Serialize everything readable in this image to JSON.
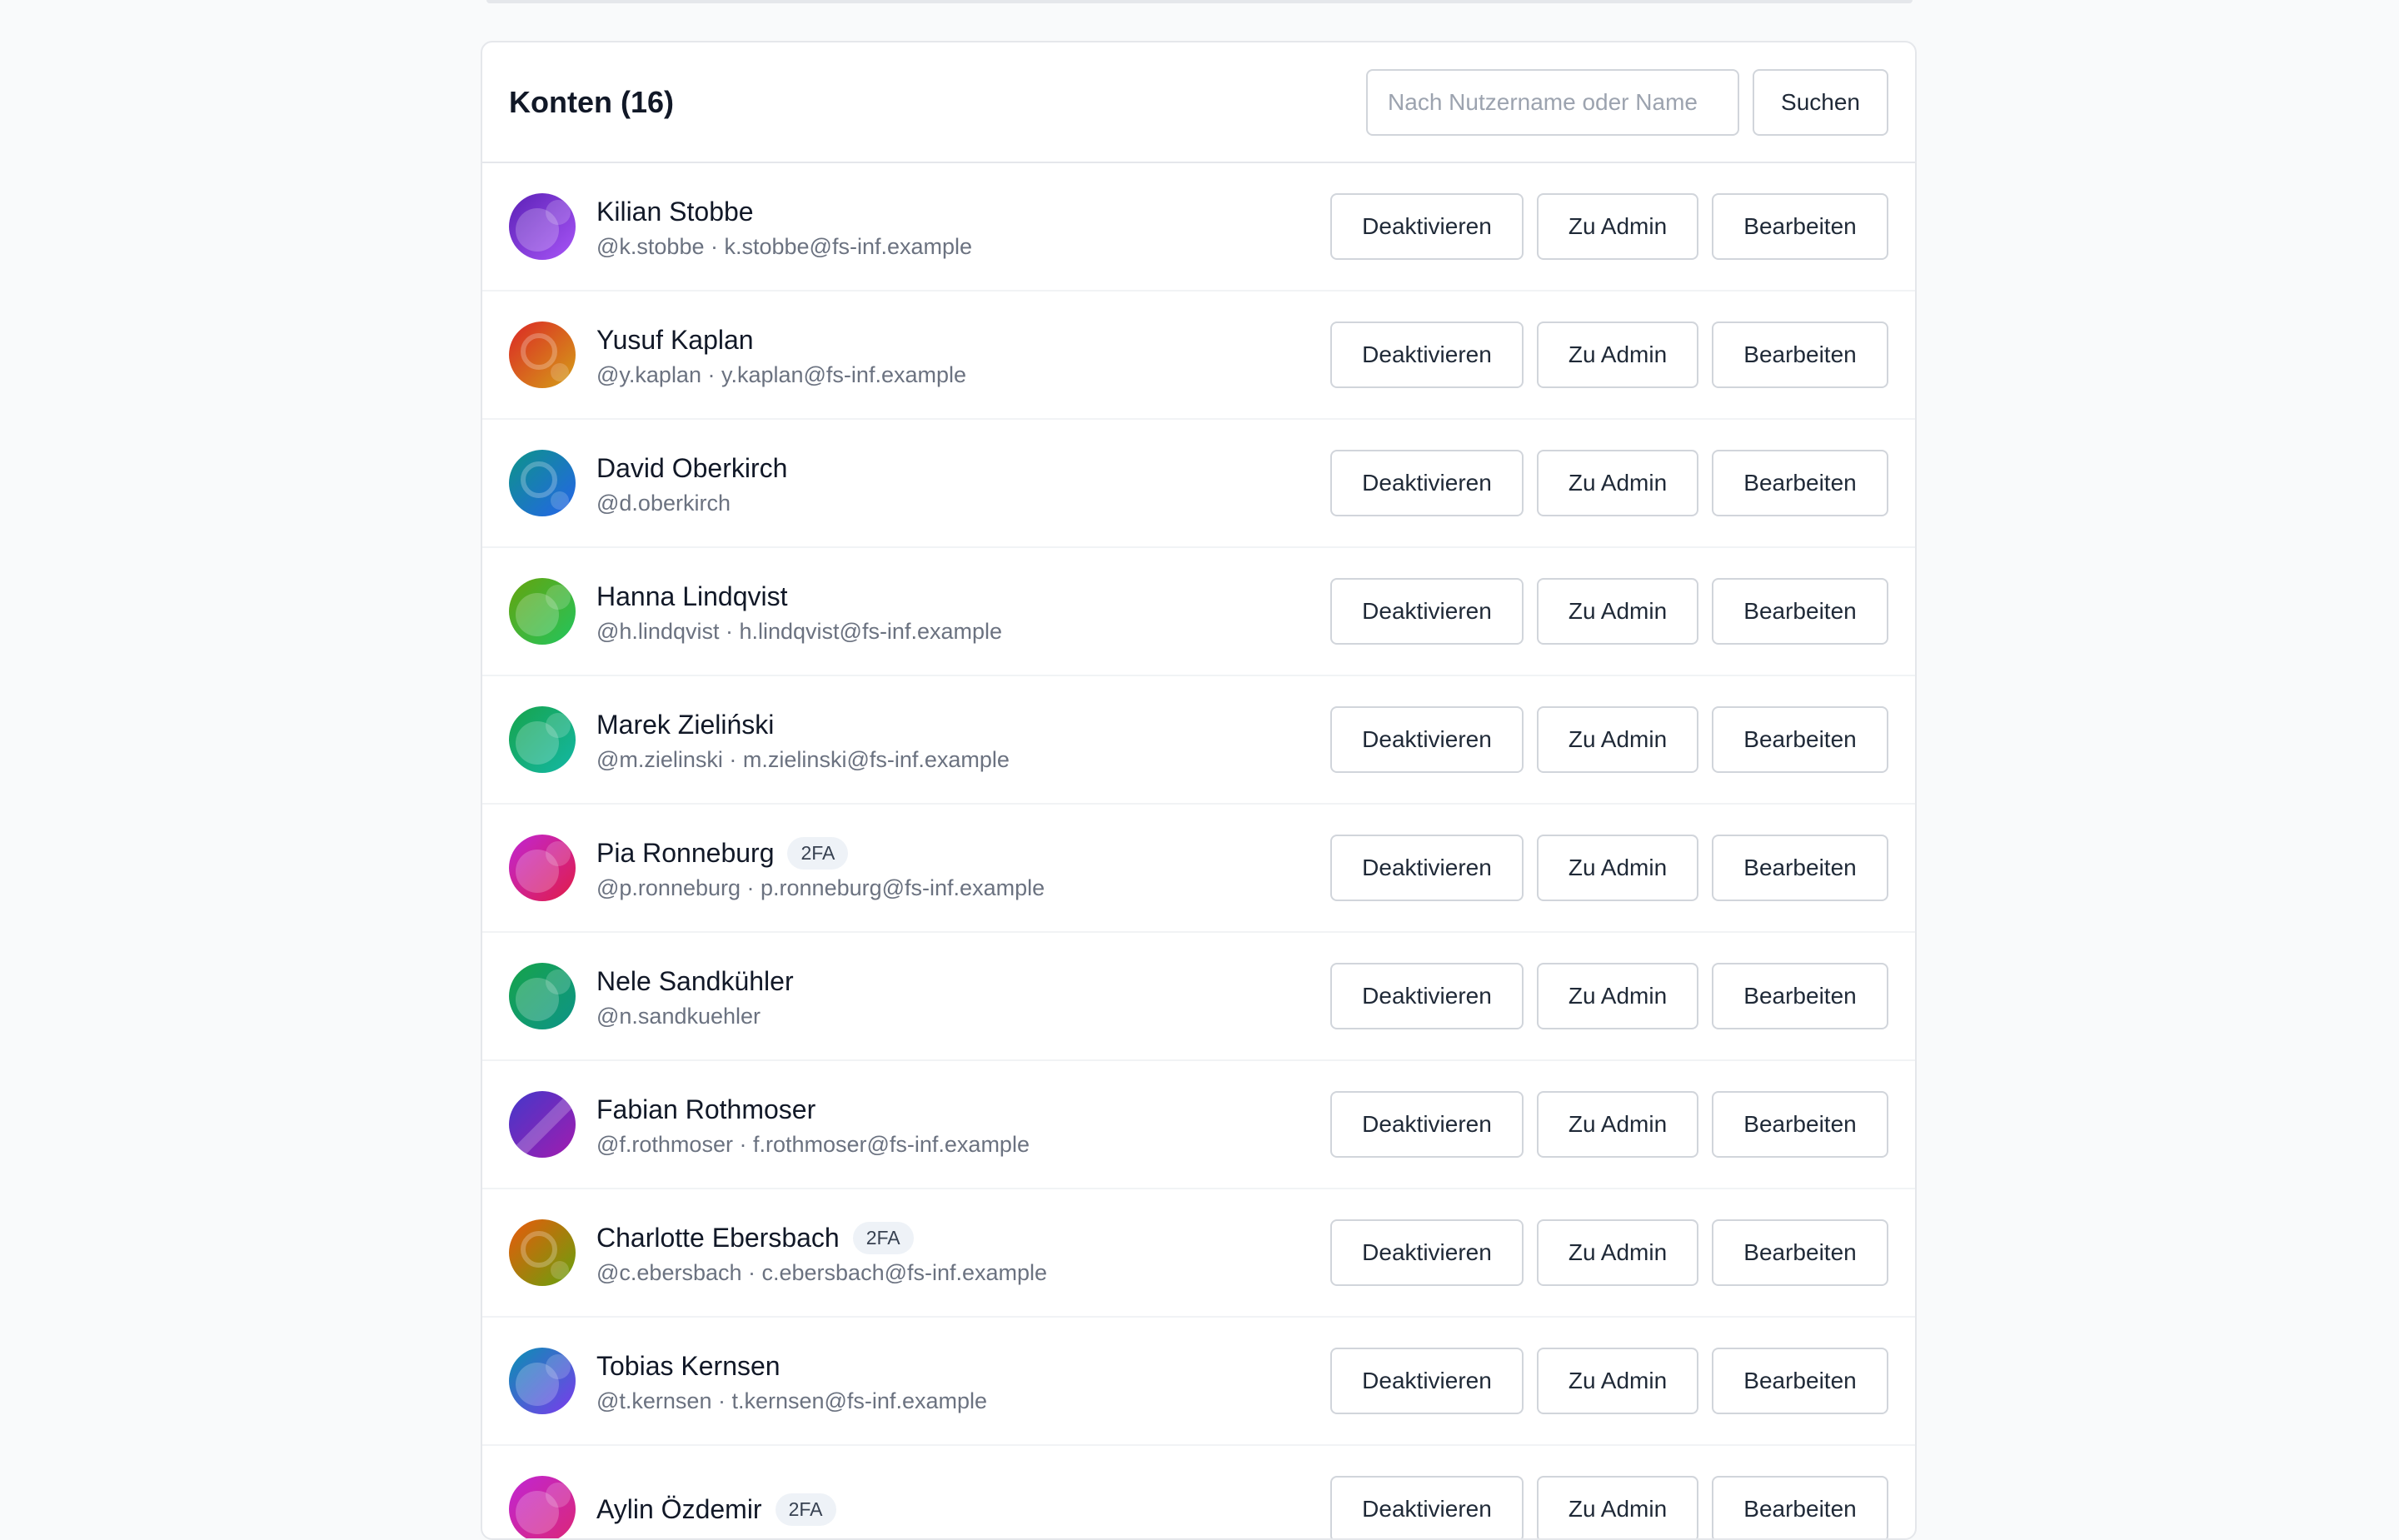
{
  "header": {
    "title": "Konten (16)",
    "search_placeholder": "Nach Nutzername oder Name",
    "search_value": "",
    "search_button": "Suchen"
  },
  "actions": {
    "deactivate": "Deaktivieren",
    "make_admin": "Zu Admin",
    "edit": "Bearbeiten"
  },
  "users": [
    {
      "name": "Kilian Stobbe",
      "sub": "@k.stobbe · k.stobbe@fs-inf.example",
      "badge": "",
      "color1": "#5b21b6",
      "color2": "#a855f7",
      "pattern": "blobs"
    },
    {
      "name": "Yusuf Kaplan",
      "sub": "@y.kaplan · y.kaplan@fs-inf.example",
      "badge": "",
      "color1": "#dc2626",
      "color2": "#d4a017",
      "pattern": "ring"
    },
    {
      "name": "David Oberkirch",
      "sub": "@d.oberkirch",
      "badge": "",
      "color1": "#0d9488",
      "color2": "#2563eb",
      "pattern": "ring"
    },
    {
      "name": "Hanna Lindqvist",
      "sub": "@h.lindqvist · h.lindqvist@fs-inf.example",
      "badge": "",
      "color1": "#65a30d",
      "color2": "#22c55e",
      "pattern": "blobs"
    },
    {
      "name": "Marek Zieliński",
      "sub": "@m.zielinski · m.zielinski@fs-inf.example",
      "badge": "",
      "color1": "#16a34a",
      "color2": "#14b8a6",
      "pattern": "blobs"
    },
    {
      "name": "Pia Ronneburg",
      "sub": "@p.ronneburg · p.ronneburg@fs-inf.example",
      "badge": "2FA",
      "color1": "#c026d3",
      "color2": "#e11d48",
      "pattern": "blobs"
    },
    {
      "name": "Nele Sandkühler",
      "sub": "@n.sandkuehler",
      "badge": "",
      "color1": "#16a34a",
      "color2": "#0d9488",
      "pattern": "blobs"
    },
    {
      "name": "Fabian Rothmoser",
      "sub": "@f.rothmoser · f.rothmoser@fs-inf.example",
      "badge": "",
      "color1": "#4338ca",
      "color2": "#a21caf",
      "pattern": "stripe"
    },
    {
      "name": "Charlotte Ebersbach",
      "sub": "@c.ebersbach · c.ebersbach@fs-inf.example",
      "badge": "2FA",
      "color1": "#ea580c",
      "color2": "#65a30d",
      "pattern": "ring"
    },
    {
      "name": "Tobias Kernsen",
      "sub": "@t.kernsen · t.kernsen@fs-inf.example",
      "badge": "",
      "color1": "#0891b2",
      "color2": "#7c3aed",
      "pattern": "blobs"
    },
    {
      "name": "Aylin Özdemir",
      "sub": "",
      "badge": "2FA",
      "color1": "#c026d3",
      "color2": "#db2777",
      "pattern": "blobs"
    }
  ]
}
